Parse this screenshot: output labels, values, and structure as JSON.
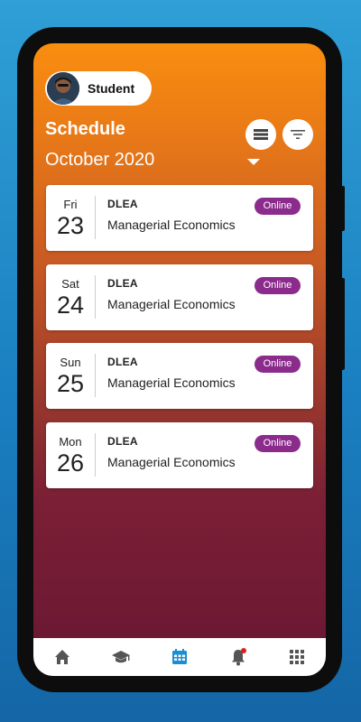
{
  "user": {
    "name": "Student"
  },
  "header": {
    "title": "Schedule",
    "month": "October 2020"
  },
  "icons": {
    "list": "list-view-icon",
    "filter": "filter-icon",
    "caret": "dropdown-caret-icon"
  },
  "schedule": [
    {
      "dow": "Fri",
      "day": "23",
      "course": "DLEA",
      "subject": "Managerial Economics",
      "mode": "Online"
    },
    {
      "dow": "Sat",
      "day": "24",
      "course": "DLEA",
      "subject": "Managerial Economics",
      "mode": "Online"
    },
    {
      "dow": "Sun",
      "day": "25",
      "course": "DLEA",
      "subject": "Managerial Economics",
      "mode": "Online"
    },
    {
      "dow": "Mon",
      "day": "26",
      "course": "DLEA",
      "subject": "Managerial Economics",
      "mode": "Online"
    }
  ],
  "tabbar": {
    "items": [
      "home-icon",
      "courses-icon",
      "calendar-icon",
      "notifications-icon",
      "apps-grid-icon"
    ],
    "active": "calendar-icon",
    "active_color": "#1a8fd4",
    "inactive_color": "#555555",
    "notification_dot_color": "#e02020"
  },
  "colors": {
    "badge": "#8b2b8c",
    "gradient_top": "#f98e0f",
    "gradient_bottom": "#6a1734"
  }
}
